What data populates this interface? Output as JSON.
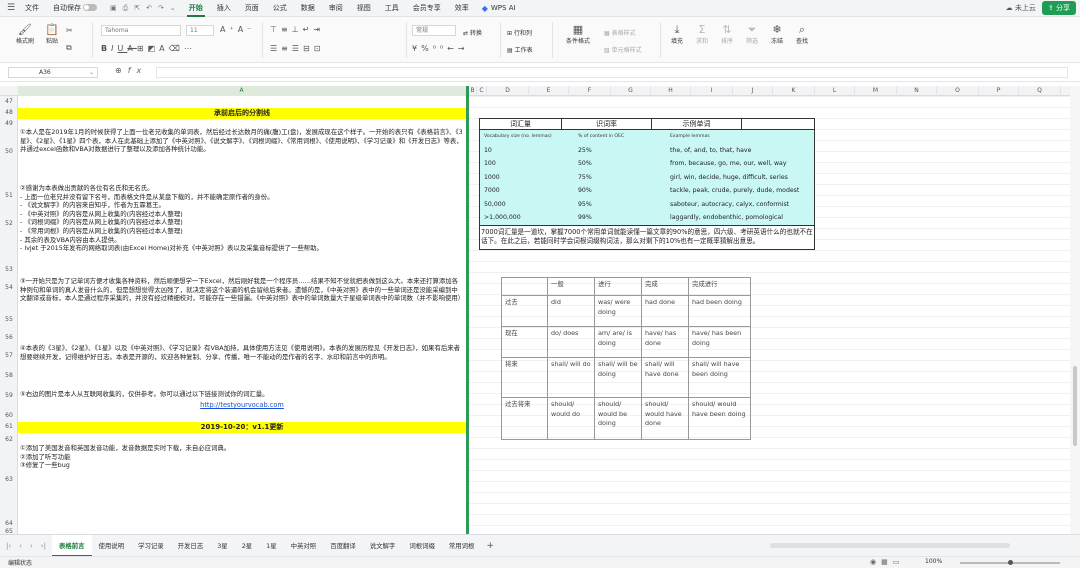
{
  "menubar": {
    "file": "文件",
    "autosave": "自动保存",
    "tabs": [
      "开始",
      "插入",
      "页面",
      "公式",
      "数据",
      "审阅",
      "视图",
      "工具",
      "会员专享",
      "效率"
    ],
    "wps_ai": "WPS AI",
    "cloud": "未上云",
    "share": "分享"
  },
  "ribbon": {
    "format_painter": "格式刷",
    "paste": "粘贴",
    "font_name": "Tahoma",
    "font_size": "11",
    "number_format": "常规",
    "convert": "转换",
    "rows_cols": "行和列",
    "worksheet": "工作表",
    "conditional_format": "条件格式",
    "table_style": "表格样式",
    "cell_style": "单元格样式",
    "fill": "填充",
    "sum": "求和",
    "sort": "排序",
    "filter": "筛选",
    "freeze": "冻结",
    "find": "查找"
  },
  "formula_bar": {
    "cell_ref": "A36"
  },
  "columns": [
    "A",
    "B",
    "C",
    "D",
    "E",
    "F",
    "G",
    "H",
    "I",
    "J",
    "K",
    "L",
    "M",
    "N",
    "O",
    "P",
    "Q"
  ],
  "rows": [
    "47",
    "48",
    "49",
    "50",
    "51",
    "52",
    "53",
    "54",
    "55",
    "56",
    "57",
    "58",
    "59",
    "60",
    "61",
    "62",
    "63",
    "64",
    "65"
  ],
  "sheet": {
    "divider_title": "承前启后的分割线",
    "p50": "①本人是在2019年1月的时候获得了上面一位老兄收集的单词表，然后经过长达数月的痛(腹)工(盘)，发展成现在这个样子。一开始的表只有《表格前言》、《3星》、《2星》、《1星》四个表，本人在此基础上添加了《中英对照》、《说文解字》、《词根词缀》、《常用词根》、《使用说明》、《学习记录》和《开发日志》等表，并通过excel函数和VBA对数据进行了整理以及添加各种统计功能。",
    "p52": "②感谢为本表做出贡献的各位有名氏和无名氏。\n- 上面一位老兄并没有留下名号，而表格文件是从某盘下载的，并不能确定原作者的身份。\n- 《说文解字》的内容来自知乎，作者为五霖葛王。\n- 《中英对照》的内容是从网上收集的(内容经过本人整理)\n- 《词根词缀》的内容是从网上收集的(内容经过本人整理)\n- 《常用词根》的内容是从网上收集的(内容经过本人整理)\n- 其余的表及VBA内容由本人提供。\n- lvjet 于2015年发布的网络取词表(由Excel Home)对补充《中英对照》表以及采集音标提供了一些帮助。",
    "p55": "③一开始只是为了记单词方便才收集各种资料，然后顺便想学一下Excel，然后刚好我是一个程序员……结果不知不觉就把表做到这么大。本来还打算添加各种例句和单词的真人发音什么的，但是想想觉得太凶残了，就决定将这个装逼的机会留给后来者。遗憾的是，《中英对照》表中的一些单词还是没能采编到中文翻译或音标，本人是通过程序采集的，并没有经过精细校对，可能存在一些错漏。《中英对照》表中的单词数量大于星级单词表中的单词数（并不影响使用）",
    "p57": "④本表的《3星》、《2星》、《1星》以及《中英对照》、《学习记录》有VBA加持，具体使用方法见《使用说明》。本表的发展历程见《开发日志》，如果有后来者想要继续开发，记得维护好日志。本表是开源的，欢迎各种复制、分享、传播，唯一不能动的是作者的名字、水印和前言中的声明。",
    "p59": "⑤右边的图片是本人从互联网收集的，仅供参考。你可以通过以下链接测试你的词汇量。",
    "link": "http://testyourvocab.com",
    "version_title": "2019-10-20：v1.1更新",
    "p62": "①添加了美国发音和英国发音功能，发音数据是实时下载，未自必应词典。\n②添加了听写功能\n③修复了一些bug"
  },
  "vocab_table": {
    "headers": [
      "词汇量",
      "识词率",
      "示例单词"
    ],
    "sub_headers": [
      "Vocabulary size (no. lemmas)",
      "% of content in OEC",
      "Example lemmas"
    ],
    "rows": [
      [
        "10",
        "25%",
        "the, of, and, to, that, have"
      ],
      [
        "100",
        "50%",
        "from, because, go, me, our, well, way"
      ],
      [
        "1000",
        "75%",
        "girl, win, decide, huge, difficult, series"
      ],
      [
        "7000",
        "90%",
        "tackle, peak, crude, purely, dude, modest"
      ],
      [
        "50,000",
        "95%",
        "saboteur, autocracy, calyx, conformist"
      ],
      [
        ">1,000,000",
        "99%",
        "laggardly, endobenthic, pomological"
      ]
    ],
    "note": "7000词汇量是一道坎，掌握7000个常用单词就能读懂一篇文章的90%的意思，四六级、考研英语什么的也就不在话下。在此之后，若能同时学会词根词缀构词法，那么对剩下的10%也有一定概率猜解出意思。"
  },
  "tense_table": {
    "header": [
      "",
      "一般",
      "进行",
      "完成",
      "完成进行"
    ],
    "rows": [
      [
        "过去",
        "did",
        "was/ were doing",
        "had done",
        "had been doing"
      ],
      [
        "现在",
        "do/ does",
        "am/ are/ is doing",
        "have/ has done",
        "have/ has been doing"
      ],
      [
        "将来",
        "shall/ will do",
        "shall/ will be doing",
        "shall/ will have done",
        "shall/ will have been doing"
      ],
      [
        "过去将来",
        "should/ would do",
        "should/ would be doing",
        "should/ would have done",
        "should/ would have been doing"
      ]
    ]
  },
  "sheet_tabs": [
    "表格前言",
    "使用说明",
    "学习记录",
    "开发日志",
    "3星",
    "2星",
    "1星",
    "中英对照",
    "百度翻译",
    "说文解字",
    "词根词缀",
    "常用词根"
  ],
  "status": {
    "mode": "编辑状态",
    "zoom": "100%"
  }
}
